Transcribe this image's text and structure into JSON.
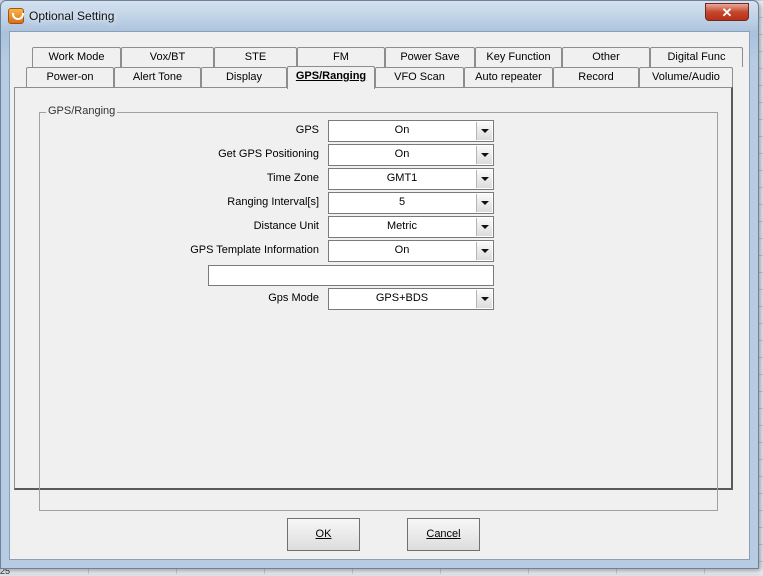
{
  "window": {
    "title": "Optional Setting",
    "close_glyph": "✕"
  },
  "background": {
    "row_number": "25"
  },
  "tabs": {
    "row1": [
      "Work Mode",
      "Vox/BT",
      "STE",
      "FM",
      "Power Save",
      "Key Function",
      "Other",
      "Digital Func"
    ],
    "row2": [
      "Power-on",
      "Alert Tone",
      "Display",
      "GPS/Ranging",
      "VFO Scan",
      "Auto repeater",
      "Record",
      "Volume/Audio"
    ],
    "active": "GPS/Ranging"
  },
  "group": {
    "title": "GPS/Ranging",
    "fields": [
      {
        "label": "GPS",
        "value": "On"
      },
      {
        "label": "Get GPS Positioning",
        "value": "On"
      },
      {
        "label": "Time Zone",
        "value": "GMT1"
      },
      {
        "label": "Ranging Interval[s]",
        "value": "5"
      },
      {
        "label": "Distance Unit",
        "value": "Metric"
      },
      {
        "label": "GPS Template Information",
        "value": "On"
      }
    ],
    "template_text": "",
    "gps_mode": {
      "label": "Gps Mode",
      "value": "GPS+BDS"
    }
  },
  "buttons": {
    "ok": "OK",
    "cancel": "Cancel"
  },
  "colors": {
    "title_gradient": "#a9c1dc",
    "close_red": "#c6472d",
    "dialog_bg": "#f0f0f0"
  },
  "icons": {
    "app": "radio-app-icon",
    "dropdown": "chevron-down-icon"
  }
}
